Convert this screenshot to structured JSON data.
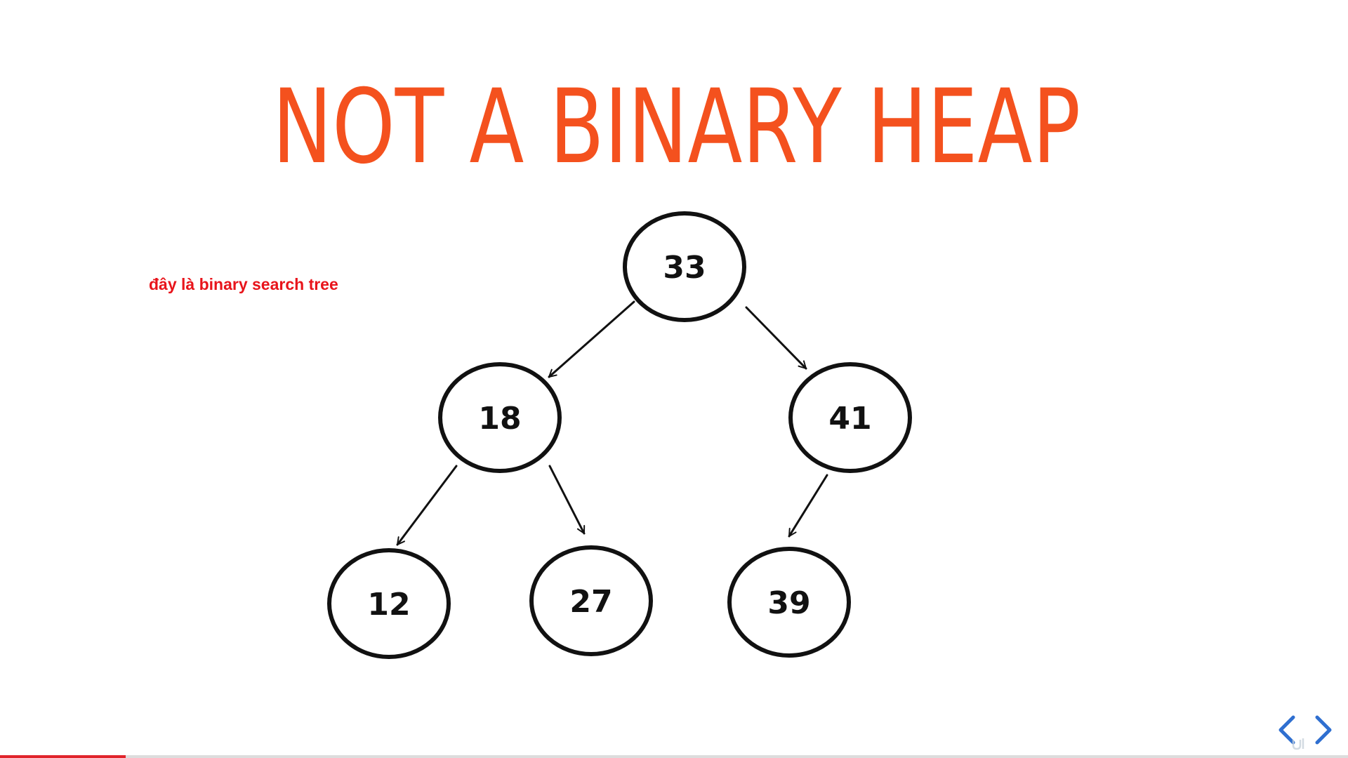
{
  "slide": {
    "title": "NOT A BINARY HEAP",
    "annotation": "đây là binary search tree"
  },
  "tree": {
    "nodes": [
      {
        "id": "n33",
        "label": "33"
      },
      {
        "id": "n18",
        "label": "18"
      },
      {
        "id": "n41",
        "label": "41"
      },
      {
        "id": "n12",
        "label": "12"
      },
      {
        "id": "n27",
        "label": "27"
      },
      {
        "id": "n39",
        "label": "39"
      }
    ],
    "edges": [
      {
        "from": "n33",
        "to": "n18"
      },
      {
        "from": "n33",
        "to": "n41"
      },
      {
        "from": "n18",
        "to": "n12"
      },
      {
        "from": "n18",
        "to": "n27"
      },
      {
        "from": "n41",
        "to": "n39"
      }
    ]
  },
  "player": {
    "progress_fraction": 0.093,
    "prev_icon": "chevron-left-icon",
    "next_icon": "chevron-right-icon",
    "watermark_icon": "udemy-logo"
  },
  "colors": {
    "title": "#f4511e",
    "annotation": "#e8141b",
    "node_stroke": "#111111",
    "progress": "#e0242b",
    "nav": "#2f6fd0"
  }
}
